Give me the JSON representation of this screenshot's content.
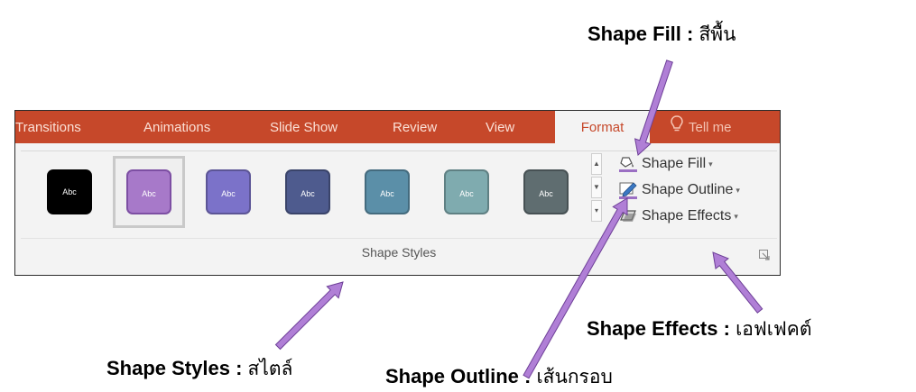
{
  "callouts": {
    "fill": {
      "name": "Shape Fill",
      "sep": " : ",
      "th": "สีพื้น"
    },
    "styles": {
      "name": "Shape Styles",
      "sep": " : ",
      "th": "สไตล์"
    },
    "outline": {
      "name": "Shape Outline",
      "sep": " : ",
      "th": "เส้นกรอบ"
    },
    "effects": {
      "name": "Shape Effects",
      "sep": " : ",
      "th": "เอฟเฟคต์"
    }
  },
  "tabs": [
    "Transitions",
    "Animations",
    "Slide Show",
    "Review",
    "View",
    "Format",
    "Tell me"
  ],
  "active_tab": "Format",
  "swatches": [
    {
      "label": "Abc",
      "color": "#000000"
    },
    {
      "label": "Abc",
      "color": "#a779c9"
    },
    {
      "label": "Abc",
      "color": "#7b72c9"
    },
    {
      "label": "Abc",
      "color": "#4e5b8e"
    },
    {
      "label": "Abc",
      "color": "#5b8fa8"
    },
    {
      "label": "Abc",
      "color": "#7fabaf"
    },
    {
      "label": "Abc",
      "color": "#5f6d70"
    }
  ],
  "commands": {
    "fill": "Shape Fill",
    "outline": "Shape Outline",
    "effects": "Shape Effects"
  },
  "group_label": "Shape Styles",
  "colors": {
    "tab_bar": "#c6482a",
    "arrow": "#b07fd6",
    "arrow_stroke": "#6d3f97"
  }
}
